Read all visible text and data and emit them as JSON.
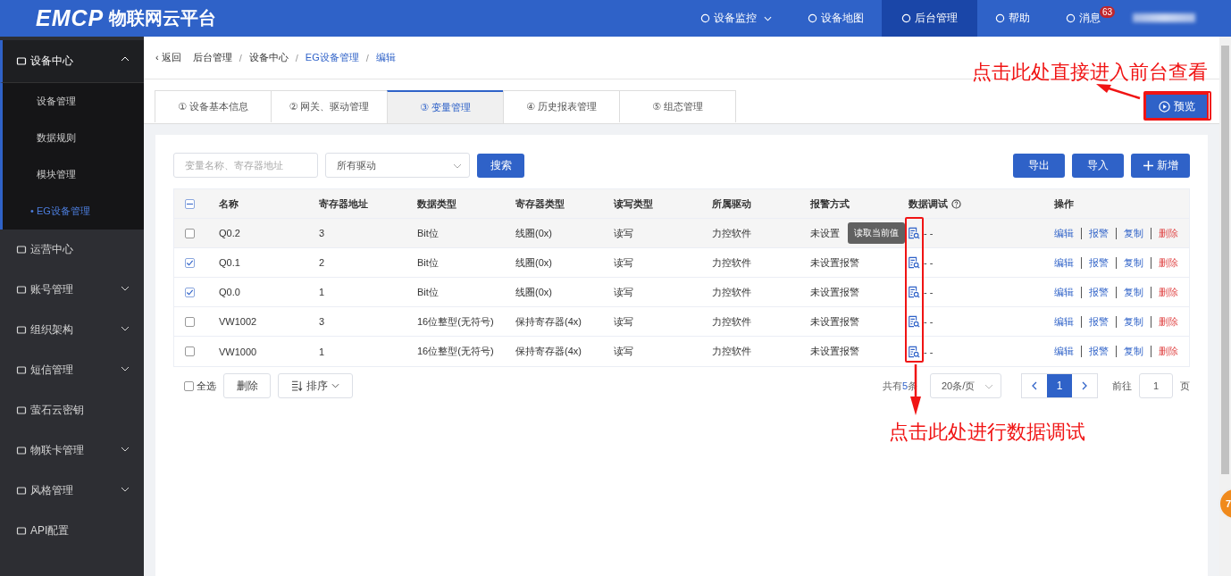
{
  "header": {
    "logo": "EMCP",
    "title": "物联网云平台",
    "nav": [
      {
        "label": "设备监控",
        "selected": false,
        "dropdown": true
      },
      {
        "label": "设备地图",
        "selected": false,
        "dropdown": false
      },
      {
        "label": "后台管理",
        "selected": true,
        "dropdown": false
      },
      {
        "label": "帮助",
        "selected": false,
        "dropdown": false
      },
      {
        "label": "消息",
        "selected": false,
        "dropdown": false,
        "badge": "63"
      }
    ]
  },
  "sidebar": {
    "items": [
      {
        "label": "设备中心",
        "kind": "group",
        "expanded": true,
        "children": [
          {
            "label": "设备管理",
            "selected": false
          },
          {
            "label": "数据规则",
            "selected": false
          },
          {
            "label": "模块管理",
            "selected": false
          },
          {
            "label": "• EG设备管理",
            "selected": true
          }
        ]
      },
      {
        "label": "运营中心",
        "kind": "link",
        "expanded": false
      },
      {
        "label": "账号管理",
        "kind": "group",
        "expanded": false
      },
      {
        "label": "组织架构",
        "kind": "group",
        "expanded": false
      },
      {
        "label": "短信管理",
        "kind": "group",
        "expanded": false
      },
      {
        "label": "萤石云密钥",
        "kind": "link",
        "expanded": false
      },
      {
        "label": "物联卡管理",
        "kind": "group",
        "expanded": false
      },
      {
        "label": "风格管理",
        "kind": "group",
        "expanded": false
      },
      {
        "label": "API配置",
        "kind": "link",
        "expanded": false
      }
    ]
  },
  "breadcrumb": {
    "back": "‹ 返回",
    "items": [
      {
        "label": "后台管理",
        "kind": "plain"
      },
      {
        "separator": "/",
        "label": "设备中心",
        "kind": "plain"
      },
      {
        "separator": "/",
        "label": "EG设备管理",
        "kind": "link"
      },
      {
        "separator": "/",
        "label": "编辑",
        "kind": "link"
      }
    ]
  },
  "tabs": [
    {
      "label": "① 设备基本信息",
      "selected": false
    },
    {
      "label": "② 网关、驱动管理",
      "selected": false
    },
    {
      "label": "③ 变量管理",
      "selected": true
    },
    {
      "label": "④ 历史报表管理",
      "selected": false
    },
    {
      "label": "⑤ 组态管理",
      "selected": false
    }
  ],
  "preview_button": "预览",
  "toolbar": {
    "search": {
      "placeholder": "变量名称、寄存器地址"
    },
    "driver_select": "所有驱动",
    "search_button": "搜索",
    "buttons": [
      {
        "label": "导出",
        "kind": "plain"
      },
      {
        "label": "导入",
        "kind": "plain"
      },
      {
        "label": "新增",
        "kind": "add"
      }
    ]
  },
  "table": {
    "select_all_indeterminate": true,
    "columns": [
      "名称",
      "寄存器地址",
      "数据类型",
      "寄存器类型",
      "读写类型",
      "所属驱动",
      "报警方式",
      "数据调试",
      "操作"
    ],
    "rows": [
      {
        "checked": false,
        "highlighted": true,
        "cells": [
          "Q0.2",
          "3",
          "Bit位",
          "线圈(0x)",
          "读写",
          "力控软件",
          "未设置"
        ],
        "debug": "- -",
        "actions": [
          {
            "label": "编辑",
            "kind": "link"
          },
          {
            "label": "报警",
            "kind": "link"
          },
          {
            "label": "复制",
            "kind": "link"
          },
          {
            "label": "删除",
            "kind": "danger"
          }
        ]
      },
      {
        "checked": true,
        "highlighted": false,
        "cells": [
          "Q0.1",
          "2",
          "Bit位",
          "线圈(0x)",
          "读写",
          "力控软件",
          "未设置报警"
        ],
        "debug": "- -",
        "actions": [
          {
            "label": "编辑",
            "kind": "link"
          },
          {
            "label": "报警",
            "kind": "link"
          },
          {
            "label": "复制",
            "kind": "link"
          },
          {
            "label": "删除",
            "kind": "danger"
          }
        ]
      },
      {
        "checked": true,
        "highlighted": false,
        "cells": [
          "Q0.0",
          "1",
          "Bit位",
          "线圈(0x)",
          "读写",
          "力控软件",
          "未设置报警"
        ],
        "debug": "- -",
        "actions": [
          {
            "label": "编辑",
            "kind": "link"
          },
          {
            "label": "报警",
            "kind": "link"
          },
          {
            "label": "复制",
            "kind": "link"
          },
          {
            "label": "删除",
            "kind": "danger"
          }
        ]
      },
      {
        "checked": false,
        "highlighted": false,
        "cells": [
          "VW1002",
          "3",
          "16位整型(无符号)",
          "保持寄存器(4x)",
          "读写",
          "力控软件",
          "未设置报警"
        ],
        "debug": "- -",
        "actions": [
          {
            "label": "编辑",
            "kind": "link"
          },
          {
            "label": "报警",
            "kind": "link"
          },
          {
            "label": "复制",
            "kind": "link"
          },
          {
            "label": "删除",
            "kind": "danger"
          }
        ]
      },
      {
        "checked": false,
        "highlighted": false,
        "cells": [
          "VW1000",
          "1",
          "16位整型(无符号)",
          "保持寄存器(4x)",
          "读写",
          "力控软件",
          "未设置报警"
        ],
        "debug": "- -",
        "actions": [
          {
            "label": "编辑",
            "kind": "link"
          },
          {
            "label": "报警",
            "kind": "link"
          },
          {
            "label": "复制",
            "kind": "link"
          },
          {
            "label": "删除",
            "kind": "danger"
          }
        ]
      }
    ],
    "tooltip": "读取当前值"
  },
  "footer": {
    "select_all": {
      "label": "全选",
      "checked": false
    },
    "delete_button": "删除",
    "sort_button": "排序"
  },
  "pagination": {
    "total_prefix": "共有",
    "total_count": "5",
    "total_suffix": "条",
    "page_size": "20条/页",
    "pages": [
      {
        "label": "1",
        "selected": true
      }
    ],
    "goto_label": "前往",
    "goto_value": "1",
    "page_suffix": "页"
  },
  "annotations": {
    "preview_note": "点击此处直接进入前台查看",
    "debug_note": "点击此处进行数据调试"
  },
  "float_badge": "7"
}
